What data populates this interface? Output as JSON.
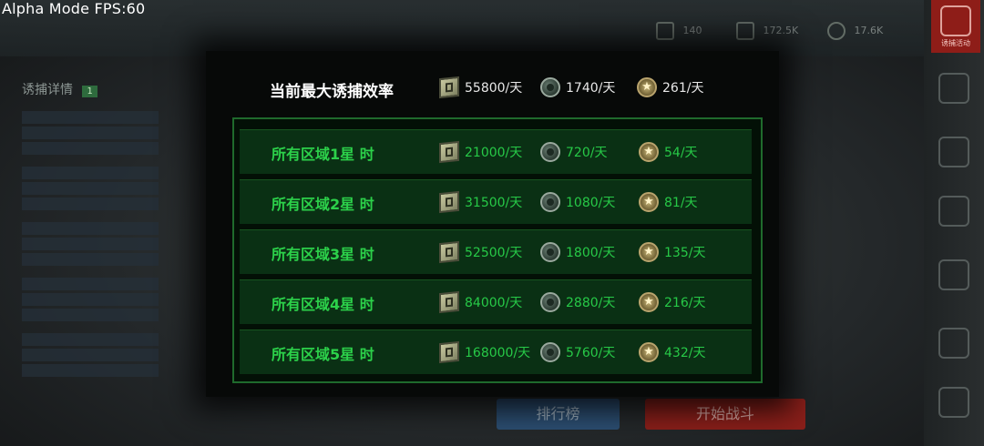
{
  "overlay": {
    "fps_label": "Alpha Mode FPS:60"
  },
  "background": {
    "top_resources": [
      "140",
      "172.5K",
      "17.6K"
    ],
    "left_panel_title": "诱捕详情",
    "left_panel_badge": "1",
    "bottom_buttons": [
      "排行榜",
      "开始战斗"
    ],
    "side_label_active": "诱捕活动"
  },
  "popup": {
    "max_efficiency": {
      "title": "当前最大诱捕效率",
      "square": "55800/天",
      "bomb": "1740/天",
      "star": "261/天"
    },
    "rows": [
      {
        "label": "所有区域1星 时",
        "square": "21000/天",
        "bomb": "720/天",
        "star": "54/天"
      },
      {
        "label": "所有区域2星 时",
        "square": "31500/天",
        "bomb": "1080/天",
        "star": "81/天"
      },
      {
        "label": "所有区域3星 时",
        "square": "52500/天",
        "bomb": "1800/天",
        "star": "135/天"
      },
      {
        "label": "所有区域4星 时",
        "square": "84000/天",
        "bomb": "2880/天",
        "star": "216/天"
      },
      {
        "label": "所有区域5星 时",
        "square": "168000/天",
        "bomb": "5760/天",
        "star": "432/天"
      }
    ]
  },
  "icons": {
    "square": "supply-crate-icon",
    "bomb": "grenade-icon",
    "star": "star-medal-icon"
  },
  "colors": {
    "accent_green": "#2cd14a",
    "border_green": "#1f6a2c",
    "active_red": "#8e1d18"
  }
}
